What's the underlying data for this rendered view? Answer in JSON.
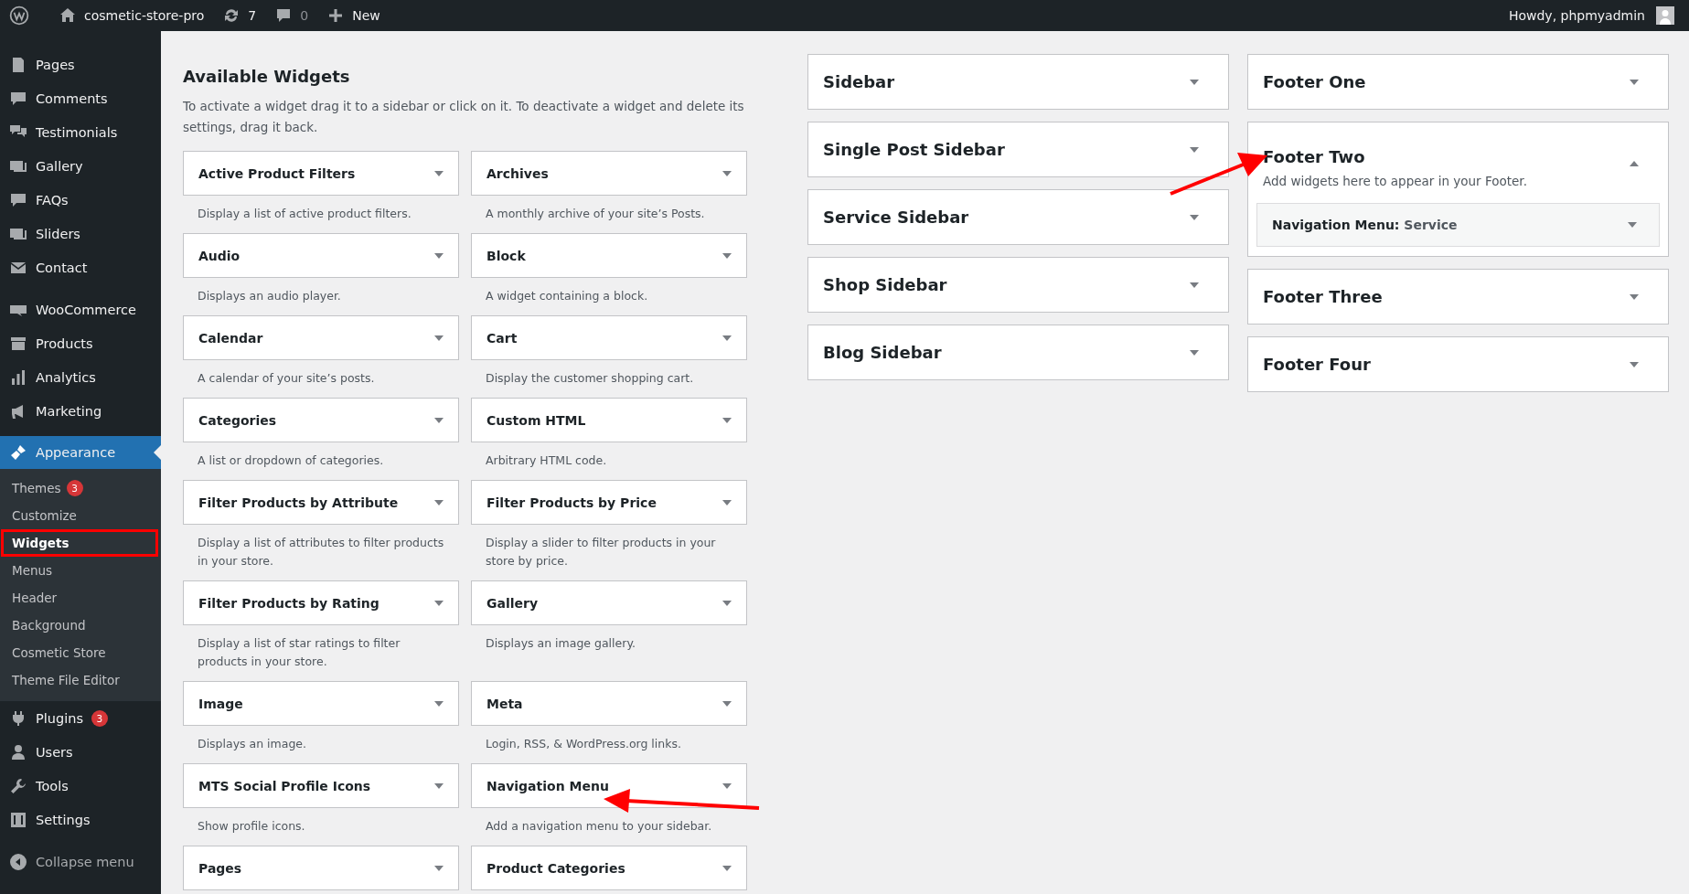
{
  "top_bar": {
    "site_name": "cosmetic-store-pro",
    "updates": "7",
    "comments": "0",
    "new_label": "New",
    "greeting": "Howdy, phpmyadmin"
  },
  "menu_groups": [
    {
      "items": [
        {
          "label": "Pages",
          "selected": false
        },
        {
          "label": "Comments",
          "selected": false
        },
        {
          "label": "Testimonials",
          "selected": false
        },
        {
          "label": "Gallery",
          "selected": false
        },
        {
          "label": "FAQs",
          "selected": false
        },
        {
          "label": "Sliders",
          "selected": false
        },
        {
          "label": "Contact",
          "selected": false
        }
      ]
    },
    {
      "items": [
        {
          "label": "WooCommerce",
          "selected": false
        },
        {
          "label": "Products",
          "selected": false
        },
        {
          "label": "Analytics",
          "selected": false
        },
        {
          "label": "Marketing",
          "selected": false
        }
      ]
    },
    {
      "items": [
        {
          "label": "Appearance",
          "selected": true,
          "children": [
            {
              "label": "Themes",
              "badge": "3",
              "selected": false,
              "highlighted": false
            },
            {
              "label": "Customize",
              "selected": false,
              "highlighted": false
            },
            {
              "label": "Widgets",
              "selected": true,
              "highlighted": true
            },
            {
              "label": "Menus",
              "selected": false,
              "highlighted": false
            },
            {
              "label": "Header",
              "selected": false,
              "highlighted": false
            },
            {
              "label": "Background",
              "selected": false,
              "highlighted": false
            },
            {
              "label": "Cosmetic Store",
              "selected": false,
              "highlighted": false
            },
            {
              "label": "Theme File Editor",
              "selected": false,
              "highlighted": false
            }
          ]
        },
        {
          "label": "Plugins",
          "badge": "3",
          "selected": false
        },
        {
          "label": "Users",
          "selected": false
        },
        {
          "label": "Tools",
          "selected": false
        },
        {
          "label": "Settings",
          "selected": false
        }
      ]
    }
  ],
  "collapse_label": "Collapse menu",
  "available_widgets": {
    "title": "Available Widgets",
    "description": "To activate a widget drag it to a sidebar or click on it. To deactivate a widget and delete its settings, drag it back.",
    "widgets": [
      {
        "name": "Active Product Filters",
        "description": "Display a list of active product filters."
      },
      {
        "name": "Archives",
        "description": "A monthly archive of your site’s Posts."
      },
      {
        "name": "Audio",
        "description": "Displays an audio player."
      },
      {
        "name": "Block",
        "description": "A widget containing a block."
      },
      {
        "name": "Calendar",
        "description": "A calendar of your site’s posts."
      },
      {
        "name": "Cart",
        "description": "Display the customer shopping cart."
      },
      {
        "name": "Categories",
        "description": "A list or dropdown of categories."
      },
      {
        "name": "Custom HTML",
        "description": "Arbitrary HTML code."
      },
      {
        "name": "Filter Products by Attribute",
        "description": "Display a list of attributes to filter products in your store."
      },
      {
        "name": "Filter Products by Price",
        "description": "Display a slider to filter products in your store by price."
      },
      {
        "name": "Filter Products by Rating",
        "description": "Display a list of star ratings to filter products in your store."
      },
      {
        "name": "Gallery",
        "description": "Displays an image gallery."
      },
      {
        "name": "Image",
        "description": "Displays an image."
      },
      {
        "name": "Meta",
        "description": "Login, RSS, & WordPress.org links."
      },
      {
        "name": "MTS Social Profile Icons",
        "description": "Show profile icons."
      },
      {
        "name": "Navigation Menu",
        "description": "Add a navigation menu to your sidebar."
      },
      {
        "name": "Pages"
      },
      {
        "name": "Product Categories"
      }
    ]
  },
  "widget_areas": [
    [
      {
        "name": "Sidebar",
        "expanded": false
      },
      {
        "name": "Single Post Sidebar",
        "expanded": false
      },
      {
        "name": "Service Sidebar",
        "expanded": false
      },
      {
        "name": "Shop Sidebar",
        "expanded": false
      },
      {
        "name": "Blog Sidebar",
        "expanded": false
      }
    ],
    [
      {
        "name": "Footer One",
        "expanded": false
      },
      {
        "name": "Footer Two",
        "expanded": true,
        "description": "Add widgets here to appear in your Footer.",
        "widgets": [
          {
            "name": "Navigation Menu:",
            "title": "Service"
          }
        ]
      },
      {
        "name": "Footer Three",
        "expanded": false
      },
      {
        "name": "Footer Four",
        "expanded": false
      }
    ]
  ]
}
